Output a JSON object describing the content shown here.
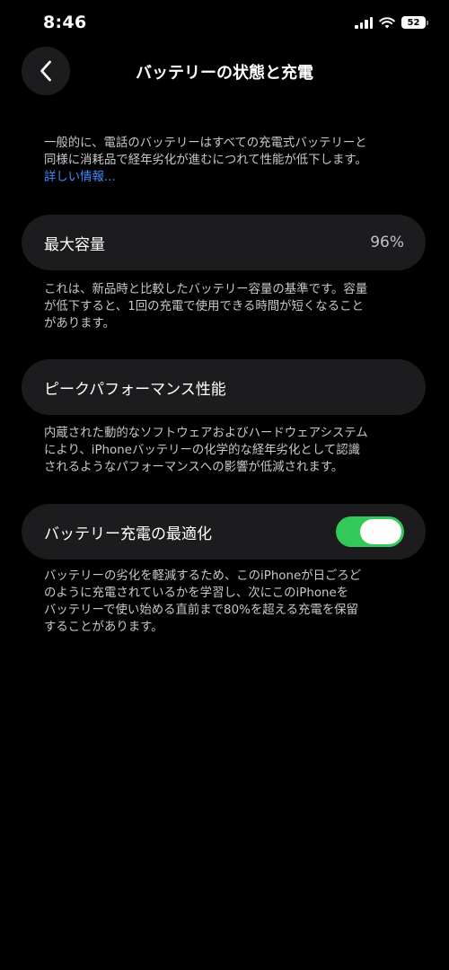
{
  "status_bar": {
    "time": "8:46",
    "battery_level": "52"
  },
  "nav": {
    "title": "バッテリーの状態と充電"
  },
  "intro": {
    "lines": [
      "一般的に、電話のバッテリーはすべての充電式バッテリーと",
      "同様に消耗品で経年劣化が進むにつれて性能が低下します。"
    ],
    "link_label": "詳しい情報..."
  },
  "max_capacity": {
    "label": "最大容量",
    "value": "96%",
    "description_lines": [
      "これは、新品時と比較したバッテリー容量の基準です。容量",
      "が低下すると、1回の充電で使用できる時間が短くなること",
      "があります。"
    ]
  },
  "peak_performance": {
    "label": "ピークパフォーマンス性能",
    "description_lines": [
      "内蔵された動的なソフトウェアおよびハードウェアシステム",
      "により、iPhoneバッテリーの化学的な経年劣化として認識",
      "されるようなパフォーマンスへの影響が低減されます。"
    ]
  },
  "optimized_charging": {
    "label": "バッテリー充電の最適化",
    "enabled": true,
    "description_lines": [
      "バッテリーの劣化を軽減するため、このiPhoneが日ごろど",
      "のように充電されているかを学習し、次にこのiPhoneを",
      "バッテリーで使い始める直前まで80%を超える充電を保留",
      "することがあります。"
    ]
  },
  "colors": {
    "background": "#000000",
    "card": "#1c1c1e",
    "toggle_on": "#34c759",
    "link": "#3f8cff"
  }
}
